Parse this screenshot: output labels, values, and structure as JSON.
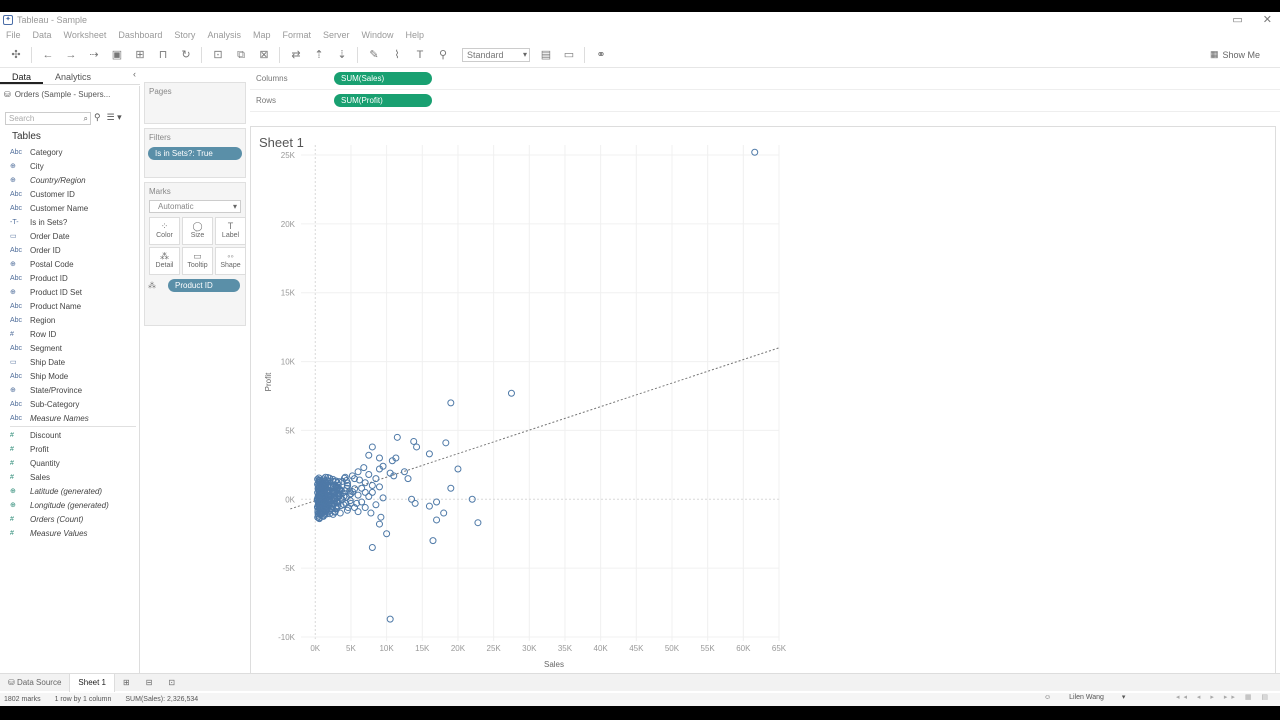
{
  "window": {
    "title": "Tableau - Sample",
    "controls": [
      "▭",
      "✕"
    ]
  },
  "menu": [
    "File",
    "Data",
    "Worksheet",
    "Dashboard",
    "Story",
    "Analysis",
    "Map",
    "Format",
    "Server",
    "Window",
    "Help"
  ],
  "toolbar": {
    "fit_label": "Standard",
    "show_me": "Show Me"
  },
  "left_tabs": {
    "data": "Data",
    "analytics": "Analytics"
  },
  "datasource": "Orders (Sample - Supers...",
  "search_placeholder": "Search",
  "tables_header": "Tables",
  "dimensions": [
    {
      "icon": "Abc",
      "label": "Category"
    },
    {
      "icon": "⊕",
      "label": "City"
    },
    {
      "icon": "⊕",
      "label": "Country/Region"
    },
    {
      "icon": "Abc",
      "label": "Customer ID"
    },
    {
      "icon": "Abc",
      "label": "Customer Name"
    },
    {
      "icon": "-T-",
      "label": "Is in Sets?"
    },
    {
      "icon": "▭",
      "label": "Order Date"
    },
    {
      "icon": "Abc",
      "label": "Order ID"
    },
    {
      "icon": "⊕",
      "label": "Postal Code"
    },
    {
      "icon": "Abc",
      "label": "Product ID"
    },
    {
      "icon": "⊕",
      "label": "Product ID Set"
    },
    {
      "icon": "Abc",
      "label": "Product Name"
    },
    {
      "icon": "Abc",
      "label": "Region"
    },
    {
      "icon": "#",
      "label": "Row ID"
    },
    {
      "icon": "Abc",
      "label": "Segment"
    },
    {
      "icon": "▭",
      "label": "Ship Date"
    },
    {
      "icon": "Abc",
      "label": "Ship Mode"
    },
    {
      "icon": "⊕",
      "label": "State/Province"
    },
    {
      "icon": "Abc",
      "label": "Sub-Category"
    },
    {
      "icon": "Abc",
      "label": "Measure Names"
    }
  ],
  "measures": [
    {
      "icon": "#",
      "label": "Discount"
    },
    {
      "icon": "#",
      "label": "Profit"
    },
    {
      "icon": "#",
      "label": "Quantity"
    },
    {
      "icon": "#",
      "label": "Sales"
    },
    {
      "icon": "⊕",
      "label": "Latitude (generated)"
    },
    {
      "icon": "⊕",
      "label": "Longitude (generated)"
    },
    {
      "icon": "#",
      "label": "Orders (Count)"
    },
    {
      "icon": "#",
      "label": "Measure Values"
    }
  ],
  "cards": {
    "pages": "Pages",
    "filters": "Filters",
    "filter_pill": "Is in Sets?: True",
    "marks": "Marks",
    "mark_type": "Automatic",
    "mark_buttons": [
      {
        "glyph": "⁘",
        "label": "Color"
      },
      {
        "glyph": "◯",
        "label": "Size"
      },
      {
        "glyph": "T",
        "label": "Label"
      },
      {
        "glyph": "⁂",
        "label": "Detail"
      },
      {
        "glyph": "▭",
        "label": "Tooltip"
      },
      {
        "glyph": "◦◦",
        "label": "Shape"
      }
    ],
    "detail_pill": "Product ID"
  },
  "shelves": {
    "columns_label": "Columns",
    "columns_pill": "SUM(Sales)",
    "rows_label": "Rows",
    "rows_pill": "SUM(Profit)"
  },
  "sheet_title": "Sheet 1",
  "colors": {
    "mark": "#4e79a7",
    "green_pill": "#19a071",
    "blue_pill": "#5a8fa8"
  },
  "chart_data": {
    "type": "scatter",
    "xlabel": "Sales",
    "ylabel": "Profit",
    "xlim": [
      -2000,
      65000
    ],
    "ylim": [
      -10000,
      25000
    ],
    "xticks": [
      0,
      5000,
      10000,
      15000,
      20000,
      25000,
      30000,
      35000,
      40000,
      45000,
      50000,
      55000,
      60000,
      65000
    ],
    "xtick_labels": [
      "0K",
      "5K",
      "10K",
      "15K",
      "20K",
      "25K",
      "30K",
      "35K",
      "40K",
      "45K",
      "50K",
      "55K",
      "60K",
      "65K"
    ],
    "yticks": [
      -10000,
      -5000,
      0,
      5000,
      10000,
      15000,
      20000,
      25000
    ],
    "ytick_labels": [
      "-10K",
      "-5K",
      "0K",
      "5K",
      "10K",
      "15K",
      "20K",
      "25K"
    ],
    "trend_line": {
      "x": [
        -3500,
        65000
      ],
      "y": [
        -700,
        11000
      ]
    },
    "points": [
      [
        61600,
        25200
      ],
      [
        27500,
        7700
      ],
      [
        19000,
        7000
      ],
      [
        11500,
        4500
      ],
      [
        13800,
        4200
      ],
      [
        18300,
        4100
      ],
      [
        14200,
        3800
      ],
      [
        16000,
        3300
      ],
      [
        8000,
        3800
      ],
      [
        7500,
        3200
      ],
      [
        9000,
        3000
      ],
      [
        10800,
        2800
      ],
      [
        11300,
        3000
      ],
      [
        9500,
        2400
      ],
      [
        20000,
        2200
      ],
      [
        12500,
        2000
      ],
      [
        13000,
        1500
      ],
      [
        11000,
        1700
      ],
      [
        10500,
        1900
      ],
      [
        19000,
        800
      ],
      [
        22000,
        0
      ],
      [
        17000,
        -200
      ],
      [
        16000,
        -500
      ],
      [
        14000,
        -300
      ],
      [
        13500,
        0
      ],
      [
        18000,
        -1000
      ],
      [
        17000,
        -1500
      ],
      [
        22800,
        -1700
      ],
      [
        16500,
        -3000
      ],
      [
        10000,
        -2500
      ],
      [
        9000,
        -1800
      ],
      [
        8000,
        -3500
      ],
      [
        10500,
        -8700
      ],
      [
        9000,
        2200
      ],
      [
        8500,
        1500
      ],
      [
        6000,
        2000
      ],
      [
        5500,
        1500
      ],
      [
        7000,
        1200
      ],
      [
        6500,
        800
      ],
      [
        4500,
        1000
      ],
      [
        3500,
        700
      ],
      [
        2500,
        500
      ],
      [
        1500,
        200
      ],
      [
        800,
        100
      ],
      [
        500,
        -100
      ],
      [
        1200,
        -300
      ],
      [
        2000,
        -500
      ],
      [
        3000,
        -700
      ],
      [
        4000,
        -400
      ],
      [
        5000,
        -300
      ],
      [
        6000,
        -900
      ],
      [
        7000,
        -600
      ],
      [
        8000,
        500
      ],
      [
        9000,
        900
      ],
      [
        7500,
        1800
      ],
      [
        6800,
        2300
      ],
      [
        5200,
        1700
      ],
      [
        4800,
        600
      ],
      [
        3800,
        1300
      ],
      [
        2800,
        1000
      ],
      [
        1800,
        600
      ],
      [
        1000,
        300
      ],
      [
        300,
        0
      ],
      [
        600,
        -500
      ],
      [
        1500,
        -900
      ],
      [
        2500,
        -1100
      ],
      [
        3500,
        -1000
      ],
      [
        4500,
        -800
      ],
      [
        5500,
        -600
      ],
      [
        6500,
        -200
      ],
      [
        7500,
        200
      ],
      [
        8500,
        -400
      ],
      [
        9500,
        100
      ],
      [
        4000,
        200
      ],
      [
        5000,
        400
      ],
      [
        6000,
        300
      ],
      [
        3000,
        100
      ],
      [
        2000,
        -200
      ],
      [
        7000,
        500
      ],
      [
        8000,
        1000
      ],
      [
        6200,
        1400
      ],
      [
        4200,
        1600
      ],
      [
        3300,
        400
      ],
      [
        5800,
        -300
      ],
      [
        7800,
        -1000
      ],
      [
        9200,
        -1300
      ],
      [
        2200,
        300
      ],
      [
        1300,
        -600
      ],
      [
        700,
        200
      ],
      [
        4600,
        -600
      ]
    ]
  },
  "bottom_tabs": {
    "datasource_tab": "Data Source",
    "sheet_tab": "Sheet 1"
  },
  "status": {
    "marks": "1802 marks",
    "rows": "1 row by 1 column",
    "sum": "SUM(Sales): 2,326,534",
    "user": "Lilen Wang"
  }
}
